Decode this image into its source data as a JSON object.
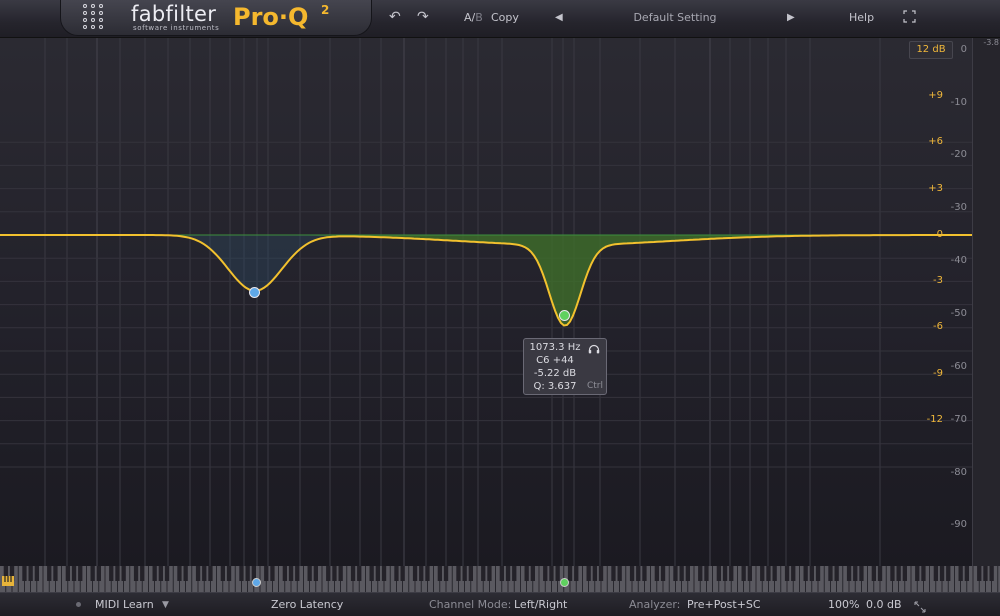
{
  "header": {
    "brand": "fabfilter",
    "brand_sub": "software instruments",
    "product": "Pro·Q",
    "product_sup": "2",
    "ab_a": "A/",
    "ab_b": "B",
    "copy_label": "Copy",
    "preset_name": "Default Setting",
    "help_label": "Help"
  },
  "graph": {
    "range_button": "12 dB",
    "gain_scale": [
      "+9",
      "+6",
      "+3",
      "0",
      "-3",
      "-6",
      "-9",
      "-12"
    ],
    "analyzer_scale": [
      "0",
      "-10",
      "-20",
      "-30",
      "-40",
      "-50",
      "-60",
      "-70",
      "-80",
      "-90"
    ],
    "meter_top_value": "-3.8",
    "bands": [
      {
        "color": "#5fa8e8",
        "gain_db": -3.6
      },
      {
        "color": "#5fd15f",
        "gain_db": -5.22,
        "frequency_hz": 1073.3,
        "q": 3.637
      }
    ],
    "tooltip": {
      "freq": "1073.3 Hz",
      "note": "C6 +44",
      "gain": "-5.22 dB",
      "q": "Q: 3.637",
      "modifier": "Ctrl",
      "icon": "headphones-icon"
    },
    "curve_color": "#f2c12e",
    "fill_color": "#3e6e2a"
  },
  "footer": {
    "midi_learn": "MIDI Learn",
    "latency": "Zero Latency",
    "channel_mode_label": "Channel Mode:",
    "channel_mode_value": "Left/Right",
    "analyzer_label": "Analyzer:",
    "analyzer_value": "Pre+Post+SC",
    "zoom": "100%",
    "output_gain": "0.0 dB"
  }
}
